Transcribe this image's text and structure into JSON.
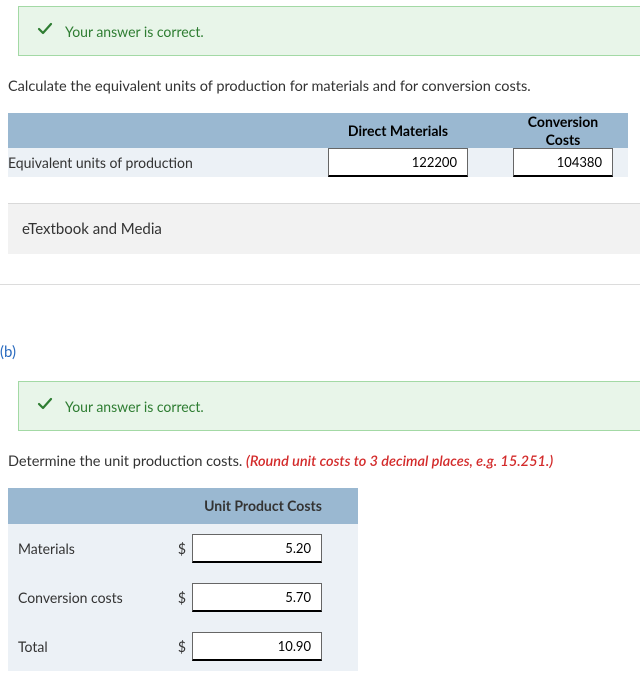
{
  "banner1": {
    "message": "Your answer is correct."
  },
  "instruction1": "Calculate the equivalent units of production for materials and for conversion costs.",
  "table1": {
    "headers": {
      "direct_materials": "Direct Materials",
      "conversion_costs": "Conversion\nCosts"
    },
    "row_label": "Equivalent units of production",
    "values": {
      "direct_materials": "122200",
      "conversion_costs": "104380"
    }
  },
  "etextbook_label": "eTextbook and Media",
  "part_b_label": "(b)",
  "banner2": {
    "message": "Your answer is correct."
  },
  "instruction2": {
    "text": "Determine the unit production costs. ",
    "note": "(Round unit costs to 3 decimal places, e.g. 15.251.)"
  },
  "table2": {
    "header": "Unit Product Costs",
    "currency": "$",
    "rows": [
      {
        "label": "Materials",
        "value": "5.20"
      },
      {
        "label": "Conversion costs",
        "value": "5.70"
      },
      {
        "label": "Total",
        "value": "10.90"
      }
    ]
  }
}
